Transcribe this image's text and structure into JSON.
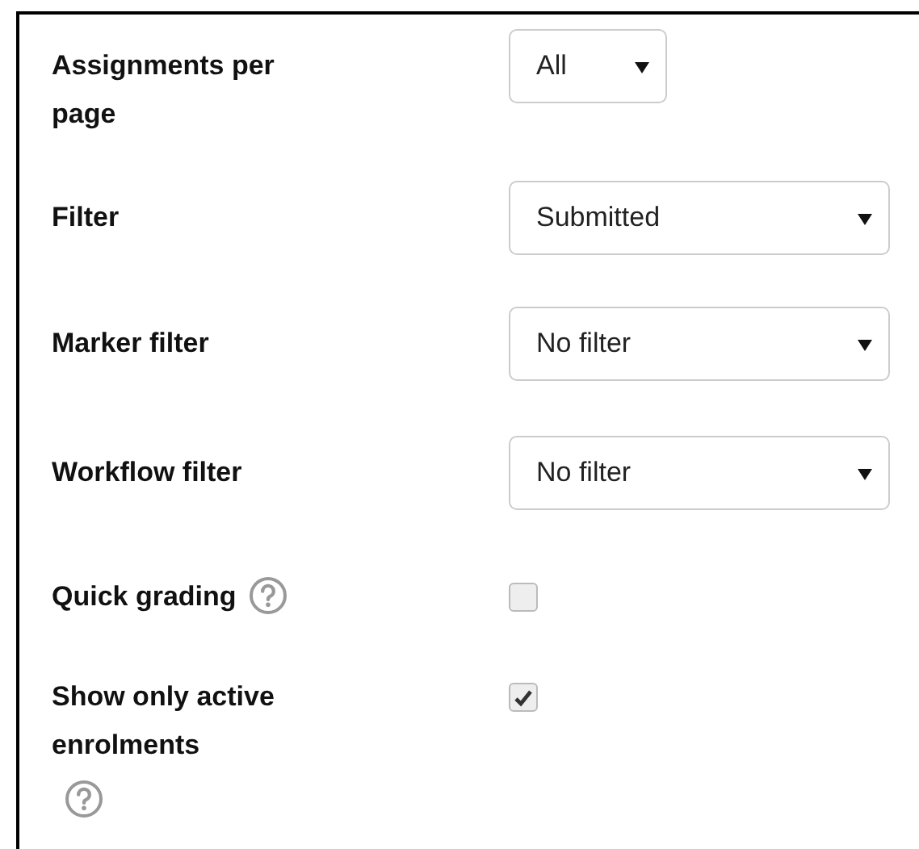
{
  "options": [
    {
      "label": "Assignments per page",
      "kind": "select",
      "value": "All",
      "wide": false
    },
    {
      "label": "Filter",
      "kind": "select",
      "value": "Submitted",
      "wide": true
    },
    {
      "label": "Marker filter",
      "kind": "select",
      "value": "No filter",
      "wide": true
    },
    {
      "label": "Workflow filter",
      "kind": "select",
      "value": "No filter",
      "wide": true
    },
    {
      "label": "Quick grading",
      "kind": "checkbox",
      "checked": false,
      "help": true,
      "help_own_line": false
    },
    {
      "label": "Show only active enrolments",
      "kind": "checkbox",
      "checked": true,
      "help": true,
      "help_own_line": true
    }
  ]
}
